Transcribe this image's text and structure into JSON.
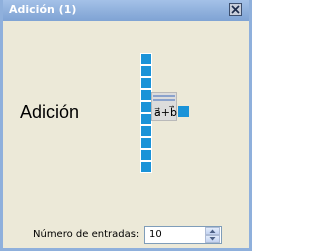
{
  "window": {
    "title": "Adición (1)",
    "close_icon": "close-icon"
  },
  "block": {
    "heading": "Adición",
    "gate_label": "a⃗+b⃗",
    "input_port_count": 10,
    "port_color": "#1a93d8"
  },
  "inputs": {
    "label": "Número de entradas:",
    "value": "10",
    "up_icon": "spin-up-icon",
    "down_icon": "spin-down-icon"
  },
  "colors": {
    "titlebar": "#8fb0dc",
    "background": "#ece9d8"
  }
}
